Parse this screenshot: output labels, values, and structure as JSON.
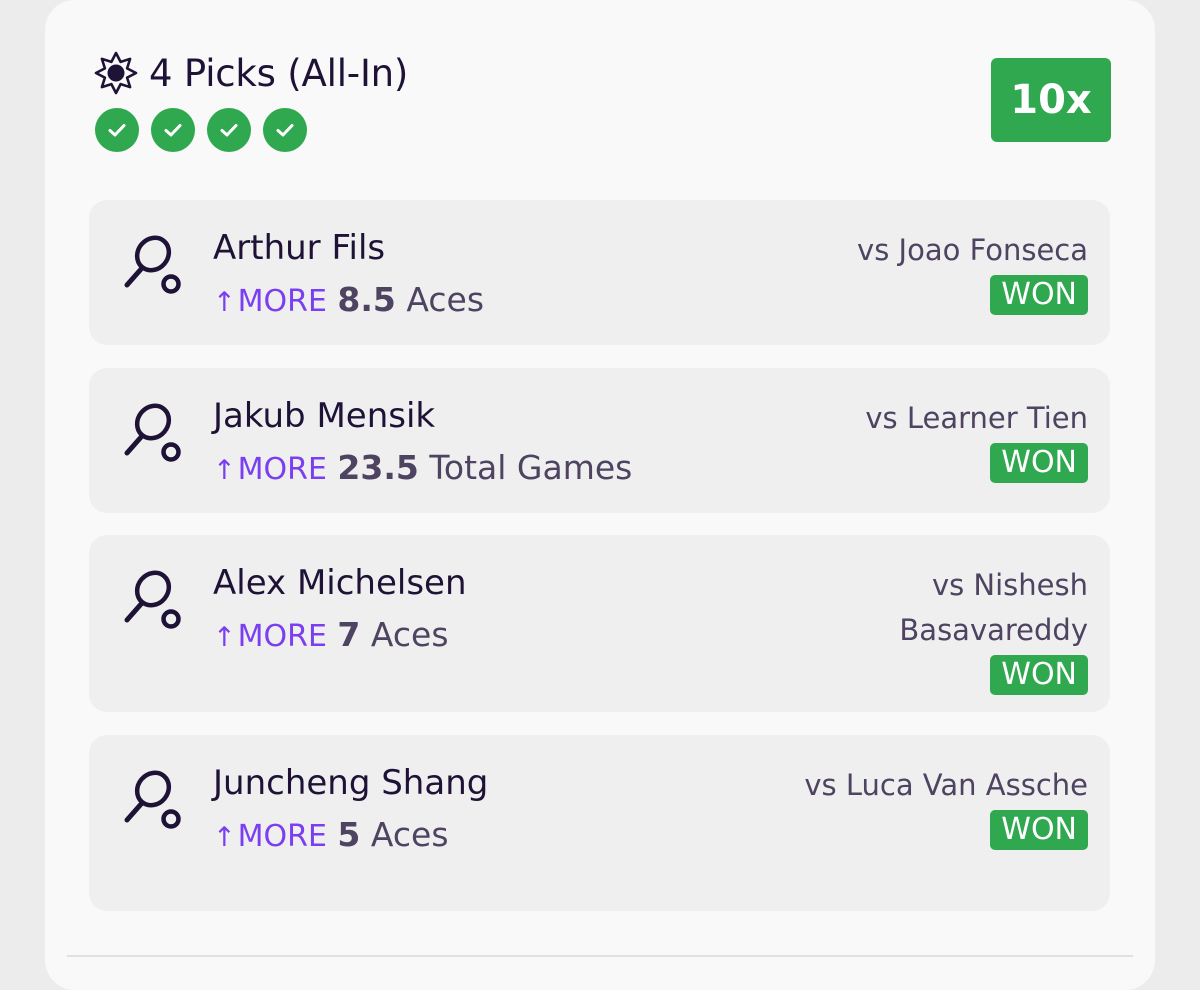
{
  "header": {
    "title": "4 Picks (All-In)",
    "icon": "star-badge-icon",
    "checks": [
      {
        "icon": "check-icon",
        "status": "won"
      },
      {
        "icon": "check-icon",
        "status": "won"
      },
      {
        "icon": "check-icon",
        "status": "won"
      },
      {
        "icon": "check-icon",
        "status": "won"
      }
    ],
    "multiplier": "10x"
  },
  "colors": {
    "success_green": "#2fa84f",
    "accent_purple": "#7a3ff0",
    "text_dark": "#1e1236",
    "text_muted": "#4e4360",
    "pick_bg": "#efefef"
  },
  "picks": [
    {
      "icon": "tennis-racket-icon",
      "player": "Arthur Fils",
      "direction_arrow": "↑",
      "direction": "MORE",
      "line": "8.5",
      "stat": "Aces",
      "opponent": "vs Joao Fonseca",
      "result": "WON"
    },
    {
      "icon": "tennis-racket-icon",
      "player": "Jakub Mensik",
      "direction_arrow": "↑",
      "direction": "MORE",
      "line": "23.5",
      "stat": "Total Games",
      "opponent": "vs Learner Tien",
      "result": "WON"
    },
    {
      "icon": "tennis-racket-icon",
      "player": "Alex Michelsen",
      "direction_arrow": "↑",
      "direction": "MORE",
      "line": "7",
      "stat": "Aces",
      "opponent": "vs Nishesh Basavareddy",
      "result": "WON"
    },
    {
      "icon": "tennis-racket-icon",
      "player": "Juncheng Shang",
      "direction_arrow": "↑",
      "direction": "MORE",
      "line": "5",
      "stat": "Aces",
      "opponent": "vs Luca Van Assche",
      "result": "WON"
    }
  ]
}
